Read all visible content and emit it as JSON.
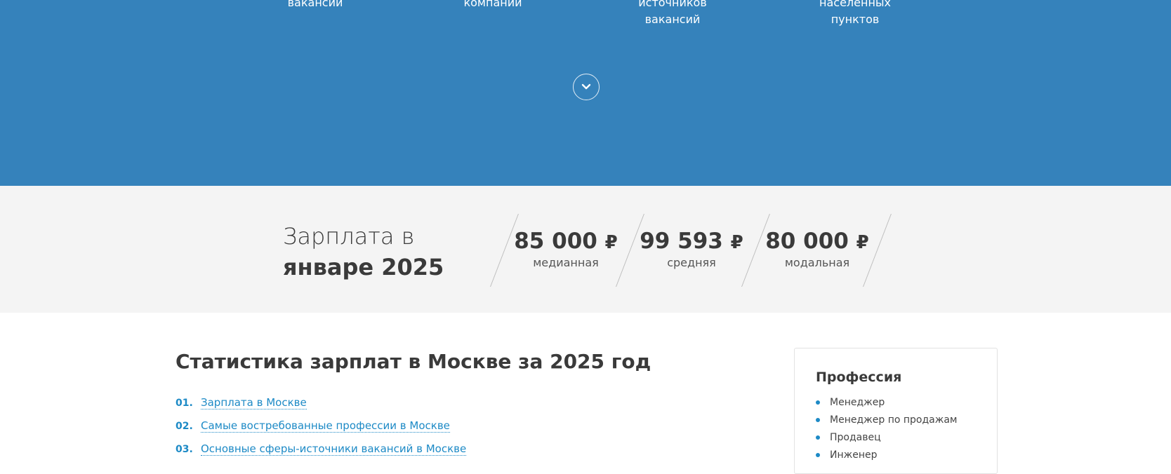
{
  "hero": {
    "stats": [
      {
        "lines": [
          "вакансий"
        ]
      },
      {
        "lines": [
          "компаний"
        ]
      },
      {
        "lines": [
          "источников",
          "вакансий"
        ]
      },
      {
        "lines": [
          "населенных",
          "пунктов"
        ]
      }
    ],
    "scroll_icon": "chevron-down-icon",
    "background": "#3582bb"
  },
  "salary": {
    "title_line1": "Зарплата в",
    "title_line2": "январе 2025",
    "currency": "₽",
    "items": [
      {
        "value": "85 000",
        "label": "медианная"
      },
      {
        "value": "99 593",
        "label": "средняя"
      },
      {
        "value": "80 000",
        "label": "модальная"
      }
    ]
  },
  "main": {
    "title": "Статистика зарплат в Москве за 2025 год",
    "toc": [
      {
        "num": "01.",
        "text": "Зарплата в Москве"
      },
      {
        "num": "02.",
        "text": "Самые востребованные профессии в Москве"
      },
      {
        "num": "03.",
        "text": "Основные сферы-источники вакансий в Москве"
      }
    ],
    "link_color": "#1d8ac6"
  },
  "sidebar": {
    "title": "Профессия",
    "items": [
      "Менеджер",
      "Менеджер по продажам",
      "Продавец",
      "Инженер"
    ]
  }
}
